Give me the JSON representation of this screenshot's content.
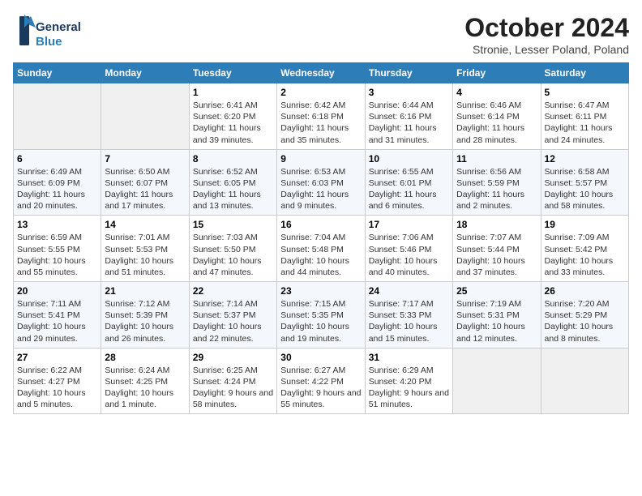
{
  "logo": {
    "line1": "General",
    "line2": "Blue"
  },
  "title": "October 2024",
  "location": "Stronie, Lesser Poland, Poland",
  "days_of_week": [
    "Sunday",
    "Monday",
    "Tuesday",
    "Wednesday",
    "Thursday",
    "Friday",
    "Saturday"
  ],
  "weeks": [
    [
      {
        "day": null
      },
      {
        "day": null
      },
      {
        "day": "1",
        "sunrise": "6:41 AM",
        "sunset": "6:20 PM",
        "daylight": "11 hours and 39 minutes."
      },
      {
        "day": "2",
        "sunrise": "6:42 AM",
        "sunset": "6:18 PM",
        "daylight": "11 hours and 35 minutes."
      },
      {
        "day": "3",
        "sunrise": "6:44 AM",
        "sunset": "6:16 PM",
        "daylight": "11 hours and 31 minutes."
      },
      {
        "day": "4",
        "sunrise": "6:46 AM",
        "sunset": "6:14 PM",
        "daylight": "11 hours and 28 minutes."
      },
      {
        "day": "5",
        "sunrise": "6:47 AM",
        "sunset": "6:11 PM",
        "daylight": "11 hours and 24 minutes."
      }
    ],
    [
      {
        "day": "6",
        "sunrise": "6:49 AM",
        "sunset": "6:09 PM",
        "daylight": "11 hours and 20 minutes."
      },
      {
        "day": "7",
        "sunrise": "6:50 AM",
        "sunset": "6:07 PM",
        "daylight": "11 hours and 17 minutes."
      },
      {
        "day": "8",
        "sunrise": "6:52 AM",
        "sunset": "6:05 PM",
        "daylight": "11 hours and 13 minutes."
      },
      {
        "day": "9",
        "sunrise": "6:53 AM",
        "sunset": "6:03 PM",
        "daylight": "11 hours and 9 minutes."
      },
      {
        "day": "10",
        "sunrise": "6:55 AM",
        "sunset": "6:01 PM",
        "daylight": "11 hours and 6 minutes."
      },
      {
        "day": "11",
        "sunrise": "6:56 AM",
        "sunset": "5:59 PM",
        "daylight": "11 hours and 2 minutes."
      },
      {
        "day": "12",
        "sunrise": "6:58 AM",
        "sunset": "5:57 PM",
        "daylight": "10 hours and 58 minutes."
      }
    ],
    [
      {
        "day": "13",
        "sunrise": "6:59 AM",
        "sunset": "5:55 PM",
        "daylight": "10 hours and 55 minutes."
      },
      {
        "day": "14",
        "sunrise": "7:01 AM",
        "sunset": "5:53 PM",
        "daylight": "10 hours and 51 minutes."
      },
      {
        "day": "15",
        "sunrise": "7:03 AM",
        "sunset": "5:50 PM",
        "daylight": "10 hours and 47 minutes."
      },
      {
        "day": "16",
        "sunrise": "7:04 AM",
        "sunset": "5:48 PM",
        "daylight": "10 hours and 44 minutes."
      },
      {
        "day": "17",
        "sunrise": "7:06 AM",
        "sunset": "5:46 PM",
        "daylight": "10 hours and 40 minutes."
      },
      {
        "day": "18",
        "sunrise": "7:07 AM",
        "sunset": "5:44 PM",
        "daylight": "10 hours and 37 minutes."
      },
      {
        "day": "19",
        "sunrise": "7:09 AM",
        "sunset": "5:42 PM",
        "daylight": "10 hours and 33 minutes."
      }
    ],
    [
      {
        "day": "20",
        "sunrise": "7:11 AM",
        "sunset": "5:41 PM",
        "daylight": "10 hours and 29 minutes."
      },
      {
        "day": "21",
        "sunrise": "7:12 AM",
        "sunset": "5:39 PM",
        "daylight": "10 hours and 26 minutes."
      },
      {
        "day": "22",
        "sunrise": "7:14 AM",
        "sunset": "5:37 PM",
        "daylight": "10 hours and 22 minutes."
      },
      {
        "day": "23",
        "sunrise": "7:15 AM",
        "sunset": "5:35 PM",
        "daylight": "10 hours and 19 minutes."
      },
      {
        "day": "24",
        "sunrise": "7:17 AM",
        "sunset": "5:33 PM",
        "daylight": "10 hours and 15 minutes."
      },
      {
        "day": "25",
        "sunrise": "7:19 AM",
        "sunset": "5:31 PM",
        "daylight": "10 hours and 12 minutes."
      },
      {
        "day": "26",
        "sunrise": "7:20 AM",
        "sunset": "5:29 PM",
        "daylight": "10 hours and 8 minutes."
      }
    ],
    [
      {
        "day": "27",
        "sunrise": "6:22 AM",
        "sunset": "4:27 PM",
        "daylight": "10 hours and 5 minutes."
      },
      {
        "day": "28",
        "sunrise": "6:24 AM",
        "sunset": "4:25 PM",
        "daylight": "10 hours and 1 minute."
      },
      {
        "day": "29",
        "sunrise": "6:25 AM",
        "sunset": "4:24 PM",
        "daylight": "9 hours and 58 minutes."
      },
      {
        "day": "30",
        "sunrise": "6:27 AM",
        "sunset": "4:22 PM",
        "daylight": "9 hours and 55 minutes."
      },
      {
        "day": "31",
        "sunrise": "6:29 AM",
        "sunset": "4:20 PM",
        "daylight": "9 hours and 51 minutes."
      },
      {
        "day": null
      },
      {
        "day": null
      }
    ]
  ],
  "labels": {
    "sunrise": "Sunrise:",
    "sunset": "Sunset:",
    "daylight": "Daylight:"
  }
}
